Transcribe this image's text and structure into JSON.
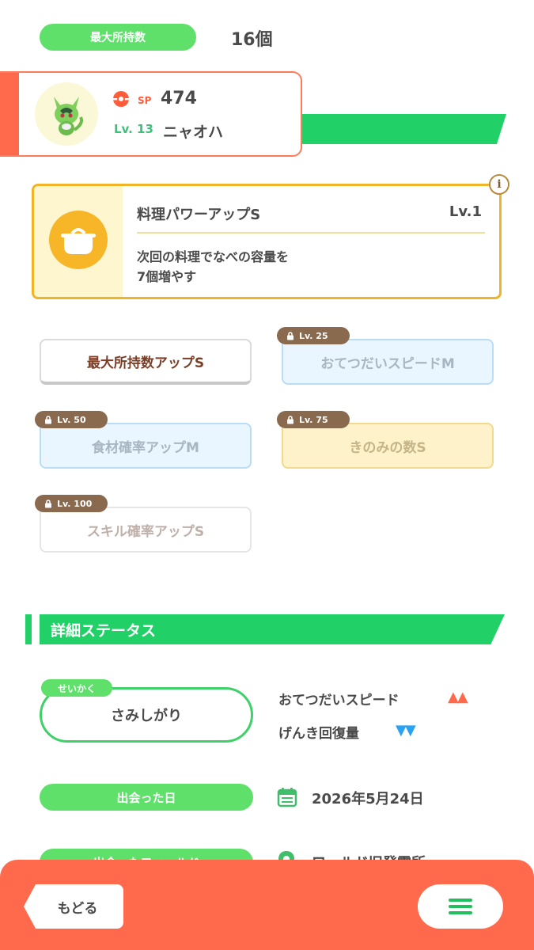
{
  "max_capacity": {
    "label": "最大所持数",
    "value": "16個"
  },
  "pokemon": {
    "sp_label": "SP",
    "sp_value": "474",
    "level": "Lv. 13",
    "name": "ニャオハ"
  },
  "main_skill": {
    "title": "料理パワーアップS",
    "level": "Lv.1",
    "description_line1": "次回の料理でなべの容量を",
    "description_line2": "7個増やす",
    "info_icon": "info-icon",
    "icon": "pot-icon"
  },
  "sub_skills": [
    {
      "label": "最大所持数アップS",
      "lock": ""
    },
    {
      "label": "おてつだいスピードM",
      "lock": "Lv. 25"
    },
    {
      "label": "食材確率アップM",
      "lock": "Lv. 50"
    },
    {
      "label": "きのみの数S",
      "lock": "Lv. 75"
    },
    {
      "label": "スキル確率アップS",
      "lock": "Lv. 100"
    }
  ],
  "details": {
    "section_title": "詳細ステータス",
    "nature_tag": "せいかく",
    "nature_value": "さみしがり",
    "nature_up": "おてつだいスピード",
    "nature_up_marks": "▲▲",
    "nature_down": "げんき回復量",
    "nature_down_marks": "▼▼",
    "met_date_label": "出会った日",
    "met_date_value": "2026年5月24日",
    "met_field_label": "出会ったフィールド",
    "met_field_value": "ワールド旧発電所"
  },
  "footer": {
    "back_label": "もどる",
    "menu_icon": "hamburger-menu-icon"
  },
  "colors": {
    "green": "#22d068",
    "light_green": "#5ee06a",
    "orange": "#ff6a4d",
    "gold": "#f0b429",
    "lock_brown": "#8a6a4e"
  }
}
